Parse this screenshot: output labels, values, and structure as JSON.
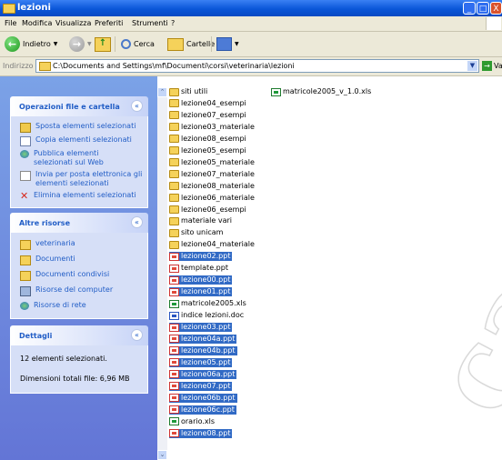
{
  "window": {
    "title": "lezioni",
    "minimize": "_",
    "maximize": "□",
    "close": "X"
  },
  "menu": [
    "File",
    "Modifica",
    "Visualizza",
    "Preferiti",
    "Strumenti",
    "?"
  ],
  "toolbar": {
    "back": "Indietro",
    "search": "Cerca",
    "folders": "Cartelle"
  },
  "address": {
    "label": "Indirizzo",
    "path": "C:\\Documents and Settings\\mf\\Documenti\\corsi\\veterinaria\\lezioni",
    "go": "Vai"
  },
  "taskpane": {
    "file_tasks": {
      "title": "Operazioni file e cartella",
      "items": [
        "Sposta elementi selezionati",
        "Copia elementi selezionati",
        "Pubblica elementi selezionati sul Web",
        "Invia per posta elettronica gli elementi selezionati",
        "Elimina elementi selezionati"
      ]
    },
    "other": {
      "title": "Altre risorse",
      "items": [
        "veterinaria",
        "Documenti",
        "Documenti condivisi",
        "Risorse del computer",
        "Risorse di rete"
      ]
    },
    "details": {
      "title": "Dettagli",
      "selected": "12 elementi selezionati.",
      "size": "Dimensioni totali file: 6,96 MB"
    }
  },
  "files": [
    {
      "name": "siti utili",
      "type": "folder",
      "selected": false
    },
    {
      "name": "lezione04_esempi",
      "type": "folder",
      "selected": false
    },
    {
      "name": "lezione07_esempi",
      "type": "folder",
      "selected": false
    },
    {
      "name": "lezione03_materiale",
      "type": "folder",
      "selected": false
    },
    {
      "name": "lezione08_esempi",
      "type": "folder",
      "selected": false
    },
    {
      "name": "lezione05_esempi",
      "type": "folder",
      "selected": false
    },
    {
      "name": "lezione05_materiale",
      "type": "folder",
      "selected": false
    },
    {
      "name": "lezione07_materiale",
      "type": "folder",
      "selected": false
    },
    {
      "name": "lezione08_materiale",
      "type": "folder",
      "selected": false
    },
    {
      "name": "lezione06_materiale",
      "type": "folder",
      "selected": false
    },
    {
      "name": "lezione06_esempi",
      "type": "folder",
      "selected": false
    },
    {
      "name": "materiale vari",
      "type": "folder",
      "selected": false
    },
    {
      "name": "sito unicam",
      "type": "folder",
      "selected": false
    },
    {
      "name": "lezione04_materiale",
      "type": "folder",
      "selected": false
    },
    {
      "name": "lezione02.ppt",
      "type": "ppt",
      "selected": true
    },
    {
      "name": "template.ppt",
      "type": "ppt",
      "selected": false
    },
    {
      "name": "lezione00.ppt",
      "type": "ppt",
      "selected": true
    },
    {
      "name": "lezione01.ppt",
      "type": "ppt",
      "selected": true
    },
    {
      "name": "matricole2005.xls",
      "type": "xls",
      "selected": false
    },
    {
      "name": "indice lezioni.doc",
      "type": "doc",
      "selected": false
    },
    {
      "name": "lezione03.ppt",
      "type": "ppt",
      "selected": true
    },
    {
      "name": "lezione04a.ppt",
      "type": "ppt",
      "selected": true
    },
    {
      "name": "lezione04b.ppt",
      "type": "ppt",
      "selected": true
    },
    {
      "name": "lezione05.ppt",
      "type": "ppt",
      "selected": true
    },
    {
      "name": "lezione06a.ppt",
      "type": "ppt",
      "selected": true
    },
    {
      "name": "lezione07.ppt",
      "type": "ppt",
      "selected": true
    },
    {
      "name": "lezione06b.ppt",
      "type": "ppt",
      "selected": true
    },
    {
      "name": "lezione06c.ppt",
      "type": "ppt",
      "selected": true
    },
    {
      "name": "orario.xls",
      "type": "xls",
      "selected": false
    },
    {
      "name": "lezione08.ppt",
      "type": "ppt",
      "selected": true
    }
  ],
  "second_column": [
    {
      "name": "matricole2005_v_1.0.xls",
      "type": "xls",
      "selected": false
    }
  ],
  "scrollbar": {
    "up": "⌃",
    "down": "⌄"
  }
}
